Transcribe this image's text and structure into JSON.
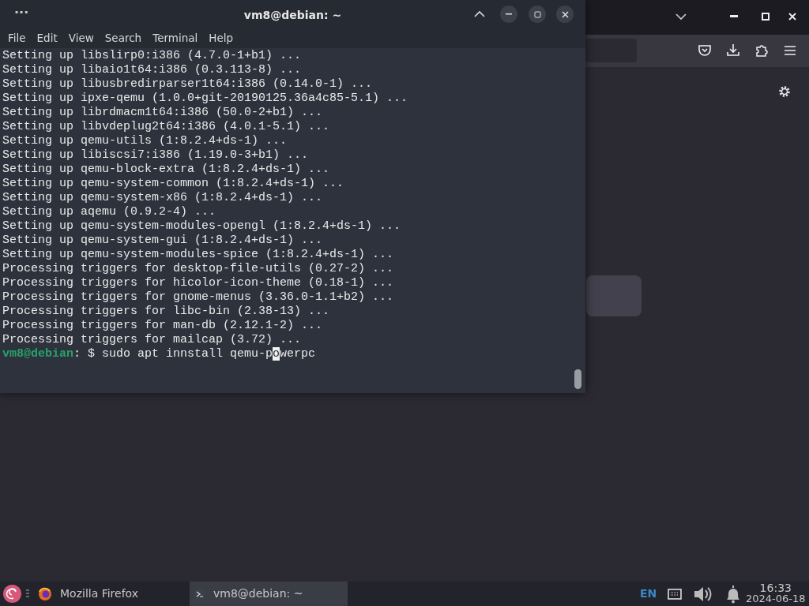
{
  "terminal": {
    "title": "vm8@debian: ~",
    "menu_handle": "···",
    "menu": [
      "File",
      "Edit",
      "View",
      "Search",
      "Terminal",
      "Help"
    ],
    "lines": [
      "Setting up libslirp0:i386 (4.7.0-1+b1) ...",
      "Setting up libaio1t64:i386 (0.3.113-8) ...",
      "Setting up libusbredirparser1t64:i386 (0.14.0-1) ...",
      "Setting up ipxe-qemu (1.0.0+git-20190125.36a4c85-5.1) ...",
      "Setting up librdmacm1t64:i386 (50.0-2+b1) ...",
      "Setting up libvdeplug2t64:i386 (4.0.1-5.1) ...",
      "Setting up qemu-utils (1:8.2.4+ds-1) ...",
      "Setting up libiscsi7:i386 (1.19.0-3+b1) ...",
      "Setting up qemu-block-extra (1:8.2.4+ds-1) ...",
      "Setting up qemu-system-common (1:8.2.4+ds-1) ...",
      "Setting up qemu-system-x86 (1:8.2.4+ds-1) ...",
      "Setting up aqemu (0.9.2-4) ...",
      "Setting up qemu-system-modules-opengl (1:8.2.4+ds-1) ...",
      "Setting up qemu-system-gui (1:8.2.4+ds-1) ...",
      "Setting up qemu-system-modules-spice (1:8.2.4+ds-1) ...",
      "Processing triggers for desktop-file-utils (0.27-2) ...",
      "Processing triggers for hicolor-icon-theme (0.18-1) ...",
      "Processing triggers for gnome-menus (3.36.0-1.1+b2) ...",
      "Processing triggers for libc-bin (2.38-13) ...",
      "Processing triggers for man-db (2.12.1-2) ...",
      "Processing triggers for mailcap (3.72) ..."
    ],
    "prompt": {
      "user_host": "vm8@debian",
      "separator": ": $ ",
      "before_cursor": "sudo apt innstall qemu-p",
      "cursor_char": "o",
      "after_cursor": "werpc"
    }
  },
  "taskbar": {
    "tasks": [
      {
        "label": "Mozilla Firefox",
        "kind": "firefox",
        "selected": false
      },
      {
        "label": "vm8@debian: ~",
        "kind": "terminal",
        "selected": true
      }
    ],
    "language": "EN",
    "time": "16:33",
    "date": "2024-06-18"
  }
}
